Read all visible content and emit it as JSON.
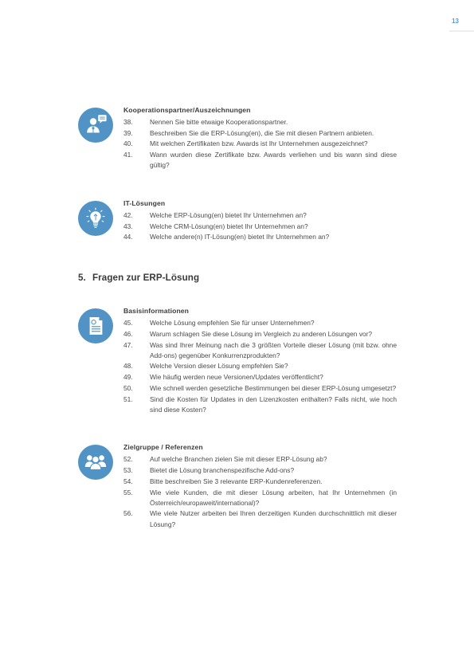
{
  "page": {
    "number": "13"
  },
  "blocks": [
    {
      "icon": "person-chat-icon",
      "title": "Kooperationspartner/Auszeichnungen",
      "questions": [
        {
          "num": "38.",
          "text": "Nennen Sie bitte etwaige Kooperationspartner."
        },
        {
          "num": "39.",
          "text": "Beschreiben Sie die ERP-Lösung(en), die Sie mit diesen Partnern anbieten."
        },
        {
          "num": "40.",
          "text": "Mit welchen Zertifikaten bzw. Awards ist Ihr Unternehmen ausgezeichnet?"
        },
        {
          "num": "41.",
          "text": "Wann wurden diese Zertifikate bzw. Awards verliehen und bis wann sind diese gültig?"
        }
      ]
    },
    {
      "icon": "lightbulb-icon",
      "title": "IT-Lösungen",
      "questions": [
        {
          "num": "42.",
          "text": "Welche ERP-Lösung(en) bietet Ihr Unternehmen an?"
        },
        {
          "num": "43.",
          "text": "Welche CRM-Lösung(en) bietet Ihr Unternehmen an?"
        },
        {
          "num": "44.",
          "text": "Welche andere(n) IT-Lösung(en) bietet Ihr Unternehmen an?"
        }
      ]
    }
  ],
  "section": {
    "number": "5.",
    "title": "Fragen zur ERP-Lösung"
  },
  "blocks2": [
    {
      "icon": "document-icon",
      "title": "Basisinformationen",
      "questions": [
        {
          "num": "45.",
          "text": "Welche Lösung empfehlen Sie für unser Unternehmen?"
        },
        {
          "num": "46.",
          "text": "Warum schlagen Sie diese Lösung im Vergleich zu anderen Lösungen vor?"
        },
        {
          "num": "47.",
          "text": "Was sind Ihrer Meinung nach die 3 größten Vorteile dieser Lösung (mit bzw. ohne Add-ons) gegenüber Konkurrenzprodukten?"
        },
        {
          "num": "48.",
          "text": "Welche Version dieser Lösung empfehlen Sie?"
        },
        {
          "num": "49.",
          "text": "Wie häufig werden neue Versionen/Updates veröffentlicht?"
        },
        {
          "num": "50.",
          "text": "Wie schnell werden gesetzliche Bestimmungen bei dieser ERP-Lösung umgesetzt?"
        },
        {
          "num": "51.",
          "text": "Sind die Kosten für Updates in den Lizenzkosten enthalten? Falls nicht, wie hoch sind diese Kosten?"
        }
      ]
    },
    {
      "icon": "people-group-icon",
      "title": "Zielgruppe / Referenzen",
      "questions": [
        {
          "num": "52.",
          "text": "Auf welche Branchen zielen Sie mit dieser ERP-Lösung ab?"
        },
        {
          "num": "53.",
          "text": "Bietet die Lösung branchenspezifische Add-ons?"
        },
        {
          "num": "54.",
          "text": "Bitte beschreiben Sie 3 relevante ERP-Kundenreferenzen."
        },
        {
          "num": "55.",
          "text": "Wie viele Kunden, die mit dieser Lösung arbeiten, hat Ihr Unternehmen (in Österreich/europaweit/international)?"
        },
        {
          "num": "56.",
          "text": "Wie viele Nutzer arbeiten bei Ihren derzeitigen Kunden durchschnittlich mit dieser Lösung?"
        }
      ]
    }
  ],
  "colors": {
    "icon_blue": "#5193c4",
    "page_number_blue": "#5b9bd0",
    "rule_gray": "#ededed",
    "body_text": "#4b4b4b"
  }
}
